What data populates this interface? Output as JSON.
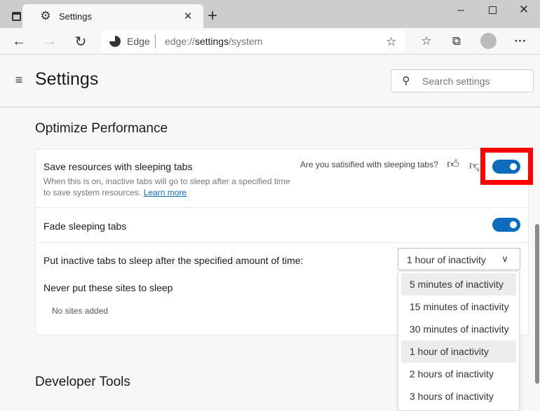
{
  "browser": {
    "tab_title": "Settings",
    "url_brand": "Edge",
    "url_prefix": "edge://",
    "url_bold": "settings",
    "url_suffix": "/system"
  },
  "header": {
    "title": "Settings",
    "search_placeholder": "Search settings"
  },
  "section": {
    "title": "Optimize Performance"
  },
  "sleeping_tabs": {
    "label": "Save resources with sleeping tabs",
    "description": "When this is on, inactive tabs will go to sleep after a specified time to save system resources.",
    "learn_more": "Learn more",
    "feedback": "Are you satisified with sleeping tabs?",
    "enabled": true
  },
  "fade": {
    "label": "Fade sleeping tabs",
    "enabled": true
  },
  "sleep_after": {
    "label": "Put inactive tabs to sleep after the specified amount of time:",
    "selected": "1 hour of inactivity",
    "options": [
      "5 minutes of inactivity",
      "15 minutes of inactivity",
      "30 minutes of inactivity",
      "1 hour of inactivity",
      "2 hours of inactivity",
      "3 hours of inactivity"
    ]
  },
  "never_sleep": {
    "label": "Never put these sites to sleep",
    "empty": "No sites added"
  },
  "next_section": {
    "title": "Developer Tools"
  },
  "colors": {
    "accent": "#0f6cbd",
    "highlight": "#ff0000"
  }
}
